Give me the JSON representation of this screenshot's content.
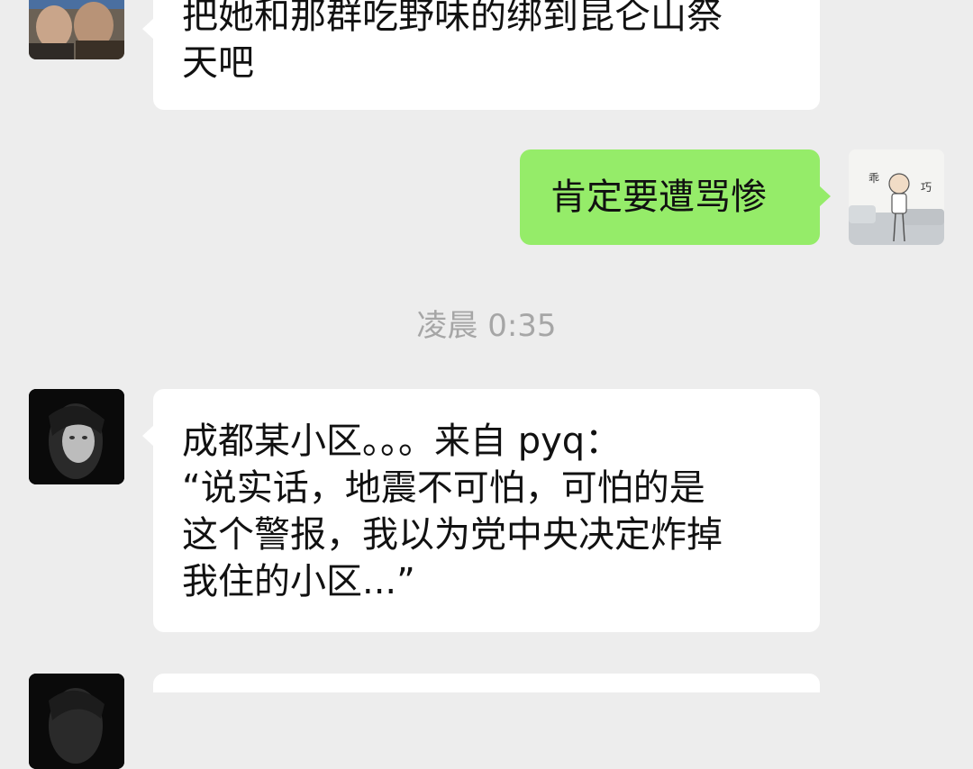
{
  "messages": [
    {
      "sender": "other",
      "lines": [
        "把她和那群吃野味的绑到昆仑山祭",
        "天吧"
      ]
    },
    {
      "sender": "self",
      "lines": [
        "肯定要遭骂惨"
      ],
      "avatar_text": [
        "乖",
        "巧"
      ]
    },
    {
      "sender": "other",
      "lines": [
        "成都某小区。。。来自 pyq：",
        "“说实话，地震不可怕，可怕的是",
        "这个警报，我以为党中央决定炸掉",
        "我住的小区...”"
      ]
    }
  ],
  "timestamp": "凌晨 0:35"
}
